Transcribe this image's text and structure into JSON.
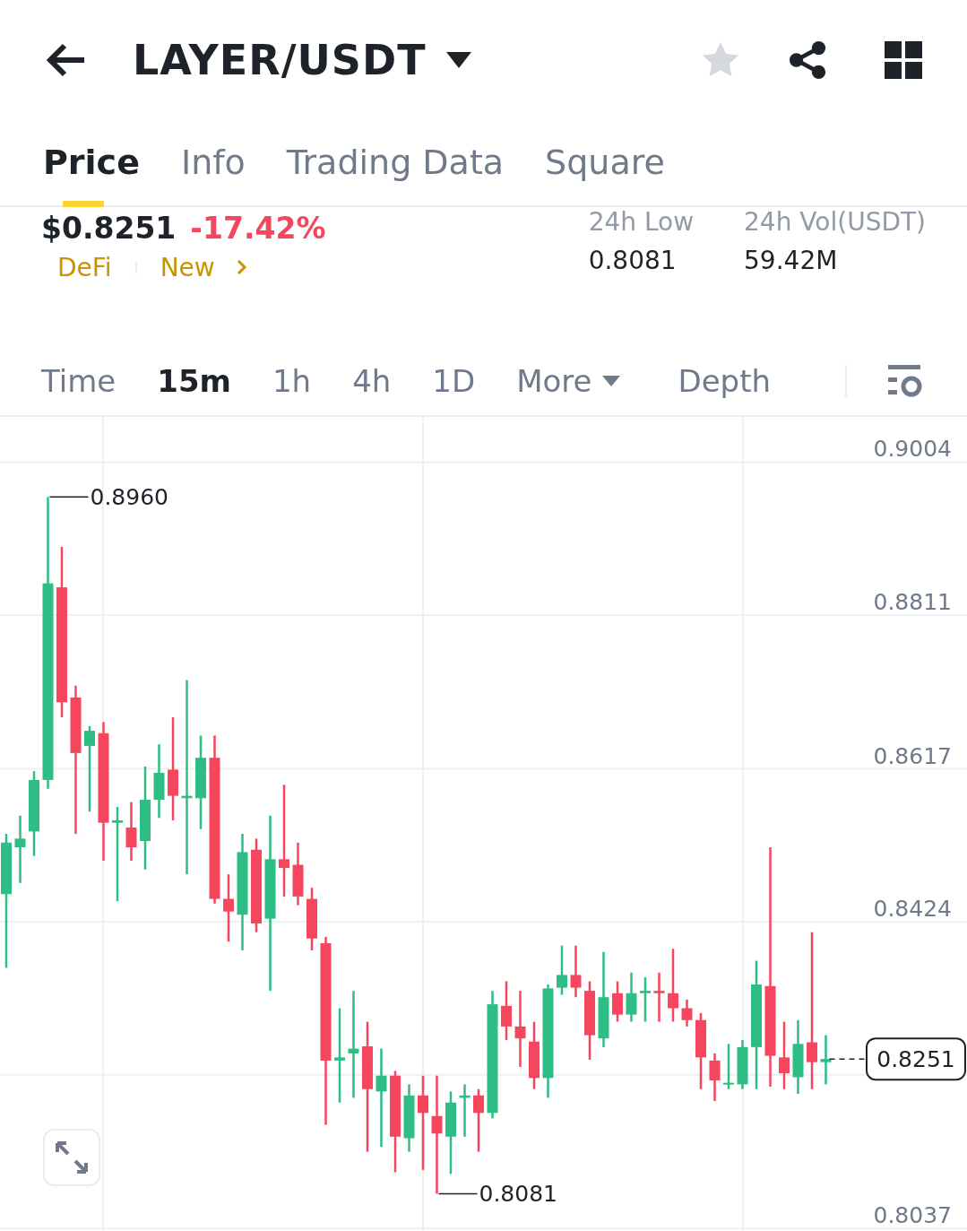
{
  "header": {
    "title": "LAYER/USDT",
    "favorite": false
  },
  "tabs": [
    {
      "label": "Price",
      "selected": true
    },
    {
      "label": "Info",
      "selected": false
    },
    {
      "label": "Trading Data",
      "selected": false
    },
    {
      "label": "Square",
      "selected": false
    }
  ],
  "ticker": {
    "price": "$0.8251",
    "change": "-17.42%",
    "tags": [
      "DeFi",
      "New"
    ],
    "stats": [
      {
        "label": "24h Low",
        "value": "0.8081"
      },
      {
        "label": "24h Vol(USDT)",
        "value": "59.42M"
      }
    ]
  },
  "intervals": [
    {
      "label": "Time",
      "selected": false,
      "kind": "plain"
    },
    {
      "label": "15m",
      "selected": true,
      "kind": "plain"
    },
    {
      "label": "1h",
      "selected": false,
      "kind": "plain"
    },
    {
      "label": "4h",
      "selected": false,
      "kind": "plain"
    },
    {
      "label": "1D",
      "selected": false,
      "kind": "plain"
    },
    {
      "label": "More",
      "selected": false,
      "kind": "dropdown"
    },
    {
      "label": "Depth",
      "selected": false,
      "kind": "plain"
    }
  ],
  "chart": {
    "current_price": "0.8251",
    "chart_data": {
      "type": "candlestick",
      "grid": true,
      "ylim": [
        0.8034,
        0.9061
      ],
      "yticks": [
        0.9004,
        0.8811,
        0.8617,
        0.8424,
        0.8037
      ],
      "annotations": [
        "0.8960",
        "0.8081"
      ],
      "ohlc": [
        [
          0.8459,
          0.8535,
          0.8366,
          0.8524
        ],
        [
          0.8518,
          0.8558,
          0.8473,
          0.8529
        ],
        [
          0.8538,
          0.8614,
          0.8507,
          0.8603
        ],
        [
          0.8603,
          0.896,
          0.8592,
          0.8851
        ],
        [
          0.8846,
          0.8897,
          0.8682,
          0.8701
        ],
        [
          0.8707,
          0.8722,
          0.8535,
          0.8637
        ],
        [
          0.8646,
          0.8671,
          0.8563,
          0.8665
        ],
        [
          0.8662,
          0.8676,
          0.8501,
          0.8549
        ],
        [
          0.8549,
          0.8569,
          0.845,
          0.8552
        ],
        [
          0.8543,
          0.8575,
          0.8501,
          0.8518
        ],
        [
          0.8526,
          0.862,
          0.849,
          0.8578
        ],
        [
          0.8578,
          0.8648,
          0.8555,
          0.8612
        ],
        [
          0.8616,
          0.8682,
          0.8552,
          0.8583
        ],
        [
          0.858,
          0.8729,
          0.8484,
          0.8583
        ],
        [
          0.858,
          0.8659,
          0.8541,
          0.8631
        ],
        [
          0.8631,
          0.8659,
          0.8447,
          0.8453
        ],
        [
          0.8453,
          0.8484,
          0.8399,
          0.8437
        ],
        [
          0.8433,
          0.8535,
          0.8388,
          0.8512
        ],
        [
          0.8515,
          0.8529,
          0.8411,
          0.8422
        ],
        [
          0.8428,
          0.8558,
          0.8337,
          0.8503
        ],
        [
          0.8503,
          0.8597,
          0.8456,
          0.8492
        ],
        [
          0.8496,
          0.8524,
          0.8445,
          0.8456
        ],
        [
          0.8453,
          0.8467,
          0.8388,
          0.8403
        ],
        [
          0.8397,
          0.8405,
          0.8168,
          0.8249
        ],
        [
          0.8249,
          0.8315,
          0.8196,
          0.8253
        ],
        [
          0.8258,
          0.8337,
          0.8202,
          0.8264
        ],
        [
          0.8267,
          0.8298,
          0.8134,
          0.8213
        ],
        [
          0.821,
          0.8264,
          0.814,
          0.823
        ],
        [
          0.823,
          0.8236,
          0.8108,
          0.8153
        ],
        [
          0.8151,
          0.8219,
          0.8134,
          0.8205
        ],
        [
          0.8205,
          0.823,
          0.8111,
          0.8183
        ],
        [
          0.8179,
          0.823,
          0.8081,
          0.8157
        ],
        [
          0.8153,
          0.821,
          0.8106,
          0.8196
        ],
        [
          0.8202,
          0.8219,
          0.8153,
          0.8205
        ],
        [
          0.8205,
          0.8213,
          0.8134,
          0.8183
        ],
        [
          0.8183,
          0.8337,
          0.8176,
          0.832
        ],
        [
          0.8318,
          0.8349,
          0.8275,
          0.8292
        ],
        [
          0.8292,
          0.8337,
          0.8241,
          0.8277
        ],
        [
          0.8273,
          0.8298,
          0.8213,
          0.8227
        ],
        [
          0.8227,
          0.8345,
          0.8202,
          0.834
        ],
        [
          0.8341,
          0.8394,
          0.8332,
          0.8357
        ],
        [
          0.8357,
          0.8394,
          0.8329,
          0.8341
        ],
        [
          0.8337,
          0.8349,
          0.825,
          0.8281
        ],
        [
          0.8277,
          0.8386,
          0.8266,
          0.8329
        ],
        [
          0.8334,
          0.8349,
          0.8298,
          0.8307
        ],
        [
          0.8307,
          0.836,
          0.8298,
          0.8334
        ],
        [
          0.8334,
          0.8354,
          0.8298,
          0.8337
        ],
        [
          0.8337,
          0.836,
          0.8298,
          0.8334
        ],
        [
          0.8334,
          0.839,
          0.8298,
          0.8315
        ],
        [
          0.8315,
          0.8326,
          0.8292,
          0.83
        ],
        [
          0.83,
          0.8309,
          0.8213,
          0.8253
        ],
        [
          0.8249,
          0.8258,
          0.8198,
          0.8224
        ],
        [
          0.8219,
          0.827,
          0.8213,
          0.8221
        ],
        [
          0.8219,
          0.8275,
          0.8213,
          0.8266
        ],
        [
          0.8266,
          0.8375,
          0.8213,
          0.8345
        ],
        [
          0.8343,
          0.8518,
          0.8216,
          0.8255
        ],
        [
          0.8253,
          0.8298,
          0.8213,
          0.8233
        ],
        [
          0.8228,
          0.83,
          0.8207,
          0.827
        ],
        [
          0.8272,
          0.8411,
          0.8213,
          0.8247
        ],
        [
          0.8247,
          0.8281,
          0.8219,
          0.8251
        ]
      ]
    }
  }
}
